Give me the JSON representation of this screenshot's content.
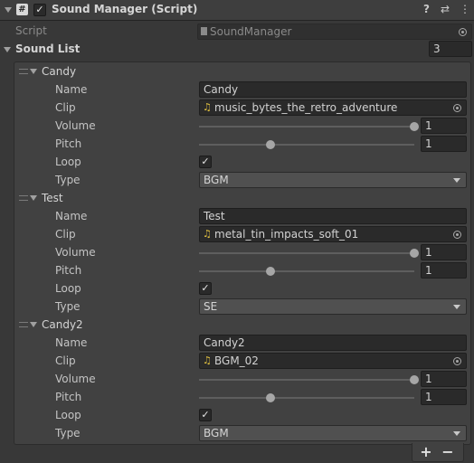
{
  "header": {
    "title": "Sound Manager (Script)",
    "script_icon": "#",
    "enabled_mark": "✓",
    "help_icon": "?",
    "settings_icon": "⇄",
    "menu_icon": "⋮"
  },
  "script_row": {
    "label": "Script",
    "value": "SoundManager"
  },
  "sound_list": {
    "label": "Sound List",
    "count": "3"
  },
  "field_labels": {
    "name": "Name",
    "clip": "Clip",
    "volume": "Volume",
    "pitch": "Pitch",
    "loop": "Loop",
    "type": "Type"
  },
  "elements": [
    {
      "title": "Candy",
      "name": "Candy",
      "clip": "music_bytes_the_retro_adventure",
      "volume": 1,
      "volume_text": "1",
      "pitch": 1,
      "pitch_text": "1",
      "loop_mark": "✓",
      "type": "BGM"
    },
    {
      "title": "Test",
      "name": "Test",
      "clip": "metal_tin_impacts_soft_01",
      "volume": 1,
      "volume_text": "1",
      "pitch": 1,
      "pitch_text": "1",
      "loop_mark": "✓",
      "type": "SE"
    },
    {
      "title": "Candy2",
      "name": "Candy2",
      "clip": "BGM_02",
      "volume": 1,
      "volume_text": "1",
      "pitch": 1,
      "pitch_text": "1",
      "loop_mark": "✓",
      "type": "BGM"
    }
  ],
  "slider_ranges": {
    "volume": [
      0,
      1
    ],
    "pitch": [
      0,
      3
    ]
  },
  "footer": {
    "add_label": "+",
    "remove_label": "−"
  },
  "icons": {
    "clip": "audio-clip-icon",
    "object_picker": "target-icon",
    "drag_handle": "drag-handle-icon"
  }
}
